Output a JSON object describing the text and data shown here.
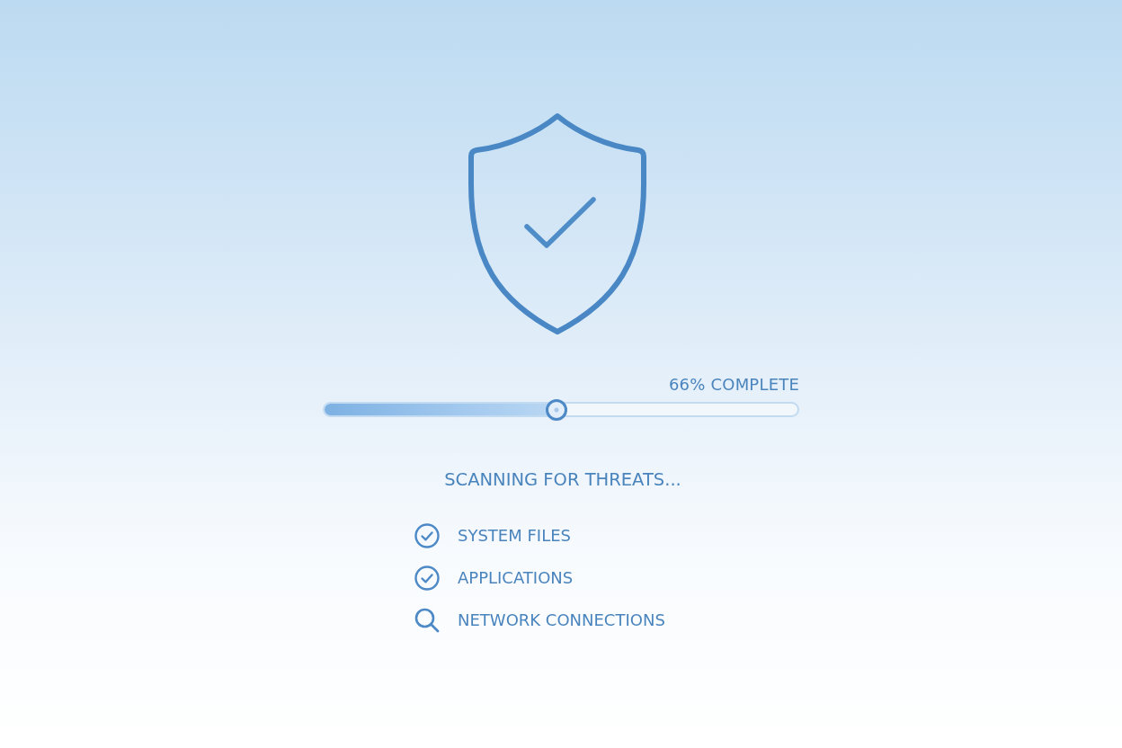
{
  "progress": {
    "label": "66% COMPLETE",
    "level": 0.49
  },
  "status": "SCANNING FOR THREATS...",
  "items": [
    {
      "label": "SYSTEM FILES",
      "kind": "done"
    },
    {
      "label": "APPLICATIONS",
      "kind": "done"
    },
    {
      "label": "NETWORK CONNECTIONS",
      "kind": "scanning"
    }
  ]
}
